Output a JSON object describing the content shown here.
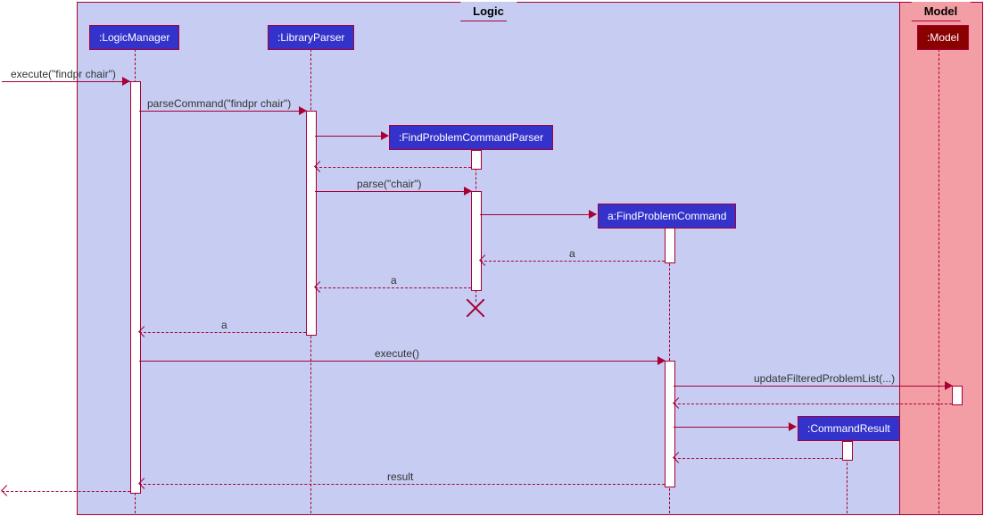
{
  "frames": {
    "logic": {
      "label": "Logic"
    },
    "model": {
      "label": "Model"
    }
  },
  "participants": {
    "logicManager": ":LogicManager",
    "libraryParser": ":LibraryParser",
    "findProblemCommandParser": ":FindProblemCommandParser",
    "findProblemCommand": "a:FindProblemCommand",
    "commandResult": ":CommandResult",
    "model": ":Model"
  },
  "messages": {
    "m1": "execute(\"findpr chair\")",
    "m2": "parseCommand(\"findpr chair\")",
    "m3": "parse(\"chair\")",
    "m4": "a",
    "m5": "a",
    "m6": "a",
    "m7": "execute()",
    "m8": "updateFilteredProblemList(...)",
    "m9": "result"
  },
  "chart_data": {
    "type": "sequence-diagram",
    "frames": [
      {
        "name": "Logic",
        "contains": [
          "LogicManager",
          "LibraryParser",
          "FindProblemCommandParser",
          "a:FindProblemCommand",
          "CommandResult"
        ]
      },
      {
        "name": "Model",
        "contains": [
          "Model"
        ]
      }
    ],
    "participants": [
      {
        "id": "LogicManager",
        "label": ":LogicManager"
      },
      {
        "id": "LibraryParser",
        "label": ":LibraryParser"
      },
      {
        "id": "FindProblemCommandParser",
        "label": ":FindProblemCommandParser",
        "created": true,
        "destroyed": true
      },
      {
        "id": "FindProblemCommand",
        "label": "a:FindProblemCommand",
        "created": true
      },
      {
        "id": "CommandResult",
        "label": ":CommandResult",
        "created": true
      },
      {
        "id": "Model",
        "label": ":Model"
      }
    ],
    "messages": [
      {
        "from": "external",
        "to": "LogicManager",
        "label": "execute(\"findpr chair\")",
        "type": "sync"
      },
      {
        "from": "LogicManager",
        "to": "LibraryParser",
        "label": "parseCommand(\"findpr chair\")",
        "type": "sync"
      },
      {
        "from": "LibraryParser",
        "to": "FindProblemCommandParser",
        "label": "",
        "type": "create"
      },
      {
        "from": "FindProblemCommandParser",
        "to": "LibraryParser",
        "label": "",
        "type": "return"
      },
      {
        "from": "LibraryParser",
        "to": "FindProblemCommandParser",
        "label": "parse(\"chair\")",
        "type": "sync"
      },
      {
        "from": "FindProblemCommandParser",
        "to": "FindProblemCommand",
        "label": "",
        "type": "create"
      },
      {
        "from": "FindProblemCommand",
        "to": "FindProblemCommandParser",
        "label": "a",
        "type": "return"
      },
      {
        "from": "FindProblemCommandParser",
        "to": "LibraryParser",
        "label": "a",
        "type": "return"
      },
      {
        "from": "FindProblemCommandParser",
        "to": null,
        "label": "",
        "type": "destroy"
      },
      {
        "from": "LibraryParser",
        "to": "LogicManager",
        "label": "a",
        "type": "return"
      },
      {
        "from": "LogicManager",
        "to": "FindProblemCommand",
        "label": "execute()",
        "type": "sync"
      },
      {
        "from": "FindProblemCommand",
        "to": "Model",
        "label": "updateFilteredProblemList(...)",
        "type": "sync"
      },
      {
        "from": "Model",
        "to": "FindProblemCommand",
        "label": "",
        "type": "return"
      },
      {
        "from": "FindProblemCommand",
        "to": "CommandResult",
        "label": "",
        "type": "create"
      },
      {
        "from": "CommandResult",
        "to": "FindProblemCommand",
        "label": "",
        "type": "return"
      },
      {
        "from": "FindProblemCommand",
        "to": "LogicManager",
        "label": "result",
        "type": "return"
      },
      {
        "from": "LogicManager",
        "to": "external",
        "label": "",
        "type": "return"
      }
    ]
  }
}
